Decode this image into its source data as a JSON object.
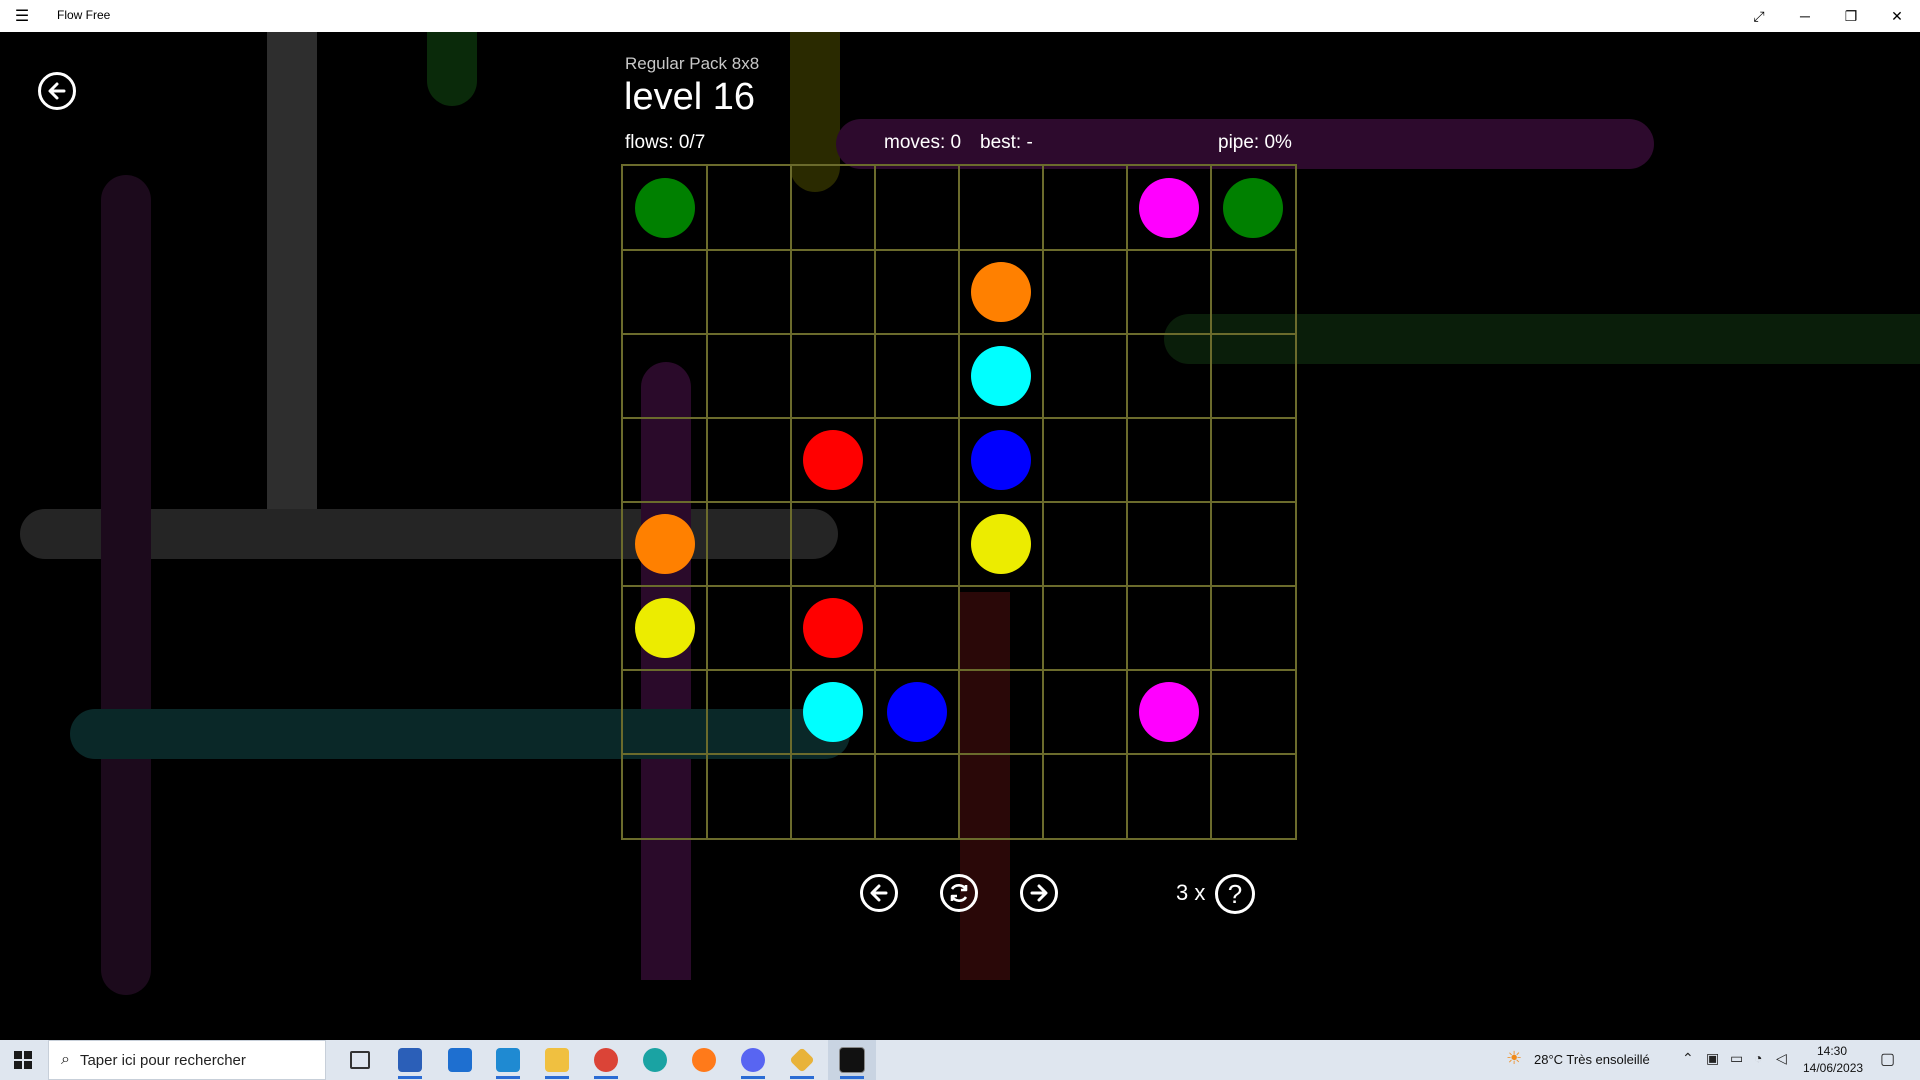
{
  "window": {
    "title": "Flow Free",
    "menu_icon": "hamburger-icon"
  },
  "header": {
    "pack": "Regular Pack 8x8",
    "level": "level 16",
    "flows": "flows: 0/7",
    "moves": "moves: 0",
    "best": "best: -",
    "pipe": "pipe: 0%"
  },
  "board": {
    "size": 8,
    "border_color": "#6b6b2c",
    "dots": [
      {
        "row": 0,
        "col": 0,
        "color": "#008000",
        "name": "green"
      },
      {
        "row": 0,
        "col": 6,
        "color": "#ff00ff",
        "name": "magenta"
      },
      {
        "row": 0,
        "col": 7,
        "color": "#008000",
        "name": "green"
      },
      {
        "row": 1,
        "col": 4,
        "color": "#ff8000",
        "name": "orange"
      },
      {
        "row": 2,
        "col": 4,
        "color": "#00ffff",
        "name": "cyan"
      },
      {
        "row": 3,
        "col": 2,
        "color": "#ff0000",
        "name": "red"
      },
      {
        "row": 3,
        "col": 4,
        "color": "#0000ff",
        "name": "blue"
      },
      {
        "row": 4,
        "col": 0,
        "color": "#ff8000",
        "name": "orange"
      },
      {
        "row": 4,
        "col": 4,
        "color": "#ecec00",
        "name": "yellow"
      },
      {
        "row": 5,
        "col": 0,
        "color": "#ecec00",
        "name": "yellow"
      },
      {
        "row": 5,
        "col": 2,
        "color": "#ff0000",
        "name": "red"
      },
      {
        "row": 6,
        "col": 2,
        "color": "#00ffff",
        "name": "cyan"
      },
      {
        "row": 6,
        "col": 3,
        "color": "#0000ff",
        "name": "blue"
      },
      {
        "row": 6,
        "col": 6,
        "color": "#ff00ff",
        "name": "magenta"
      }
    ]
  },
  "controls": {
    "back_icon": "arrow-left-circle-icon",
    "prev_icon": "arrow-left-circle-icon",
    "restart_icon": "restart-icon",
    "next_icon": "arrow-right-circle-icon",
    "hints_count": "3 x",
    "hint_symbol": "?"
  },
  "taskbar": {
    "search_placeholder": "Taper ici pour rechercher",
    "weather": "28°C  Très ensoleillé",
    "time": "14:30",
    "date": "14/06/2023"
  }
}
